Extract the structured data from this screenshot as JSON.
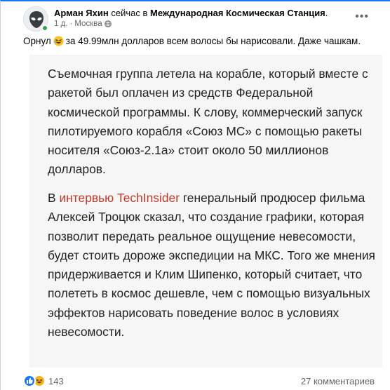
{
  "post": {
    "author": "Арман Яхин",
    "action_text": "сейчас в",
    "location": "Международная Космическая Станция",
    "location_suffix": ".",
    "time": "1 д.",
    "separator": "·",
    "city": "Москва",
    "more_icon": "more-horizontal-icon",
    "caption_before": "Орнул",
    "caption_emoji": "laughing-face-emoji",
    "caption_after": "за 49.99млн долларов всем волосы бы нарисовали. Даже чашкам."
  },
  "article": {
    "paragraph1": "Съемочная группа летела на корабле, который вместе с ракетой был оплачен из средств Федеральной космической программы. К слову, коммерческий запуск пилотируемого корабля «Союз МС» с помощью ракеты носителя «Союз-2.1а» стоит около 50 миллионов долларов.",
    "paragraph2_prefix": "В",
    "paragraph2_link": "интервью TechInsider",
    "paragraph2_rest": "генеральный продюсер фильма Алексей Троцюк сказал, что создание графики, которая позволит передать реальное ощущение невесомости, будет стоить дороже экспедиции на МКС. Того же мнения придерживается и Клим Шипенко, который считает, что полететь в космос дешевле, чем с помощью визуальных эффектов нарисовать поведение волос в условиях невесомости."
  },
  "footer": {
    "reaction_count": "143",
    "reactions": [
      "like",
      "haha"
    ],
    "comments": "27 комментариев"
  },
  "colors": {
    "accent": "#1877f2",
    "link": "#c0392b",
    "online": "#31a24c",
    "muted": "#65676b"
  }
}
